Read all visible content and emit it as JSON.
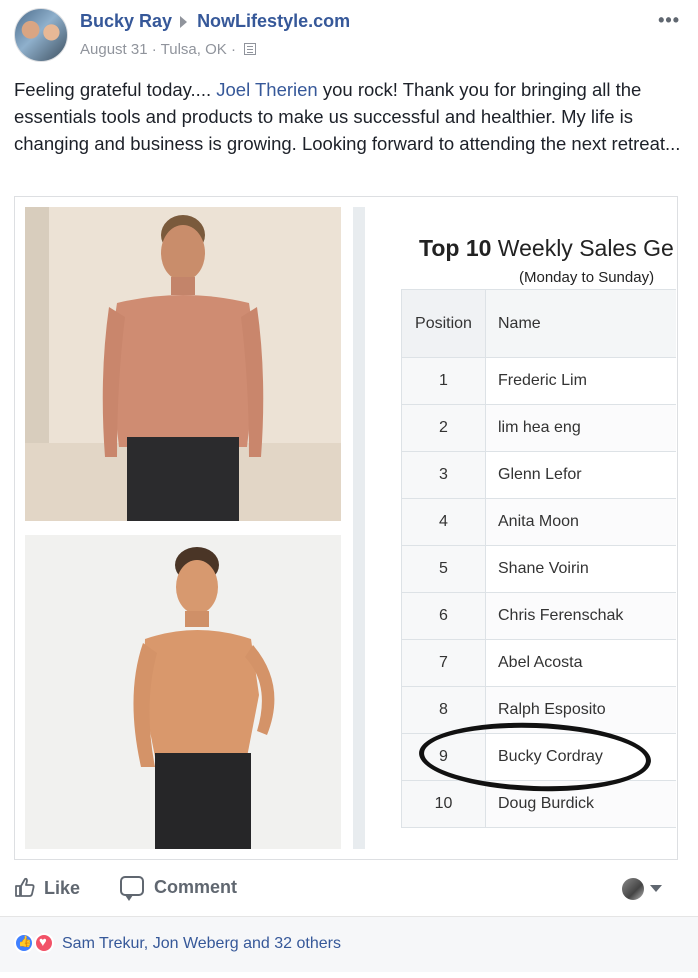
{
  "post": {
    "author": "Bucky Ray",
    "page": "NowLifestyle.com",
    "date": "August 31",
    "separator": "·",
    "location": "Tulsa, OK",
    "separator2": "·",
    "text_before_mention": "Feeling grateful today.... ",
    "mention": "Joel Therien",
    "text_after_mention": " you rock! Thank you for bringing all the essentials tools and products to make us successful and healthier. My life is changing and business is growing. Looking forward to attending the next retreat..."
  },
  "sales_image": {
    "title_bold": "Top 10",
    "title_rest": " Weekly Sales Ge",
    "subtitle": "(Monday to Sunday)",
    "col_position": "Position",
    "col_name": "Name",
    "rows": [
      {
        "pos": "1",
        "name": "Frederic Lim"
      },
      {
        "pos": "2",
        "name": "lim hea eng"
      },
      {
        "pos": "3",
        "name": "Glenn Lefor"
      },
      {
        "pos": "4",
        "name": "Anita Moon"
      },
      {
        "pos": "5",
        "name": "Shane Voirin"
      },
      {
        "pos": "6",
        "name": "Chris Ferenschak"
      },
      {
        "pos": "7",
        "name": "Abel Acosta"
      },
      {
        "pos": "8",
        "name": "Ralph Esposito"
      },
      {
        "pos": "9",
        "name": "Bucky Cordray"
      },
      {
        "pos": "10",
        "name": "Doug Burdick"
      }
    ],
    "highlighted_position": "9"
  },
  "actions": {
    "like_label": "Like",
    "comment_label": "Comment"
  },
  "reactions": {
    "names": "Sam Trekur, Jon Weberg and 32 others"
  },
  "icons": {
    "more": "more-icon",
    "like": "thumbs-up-icon",
    "comment": "comment-icon",
    "share_audience": "avatar-dropdown-icon"
  },
  "colors": {
    "link": "#365899",
    "meta": "#90949c",
    "action": "#606770",
    "like_reaction": "#4080ff",
    "love_reaction": "#f25268"
  }
}
